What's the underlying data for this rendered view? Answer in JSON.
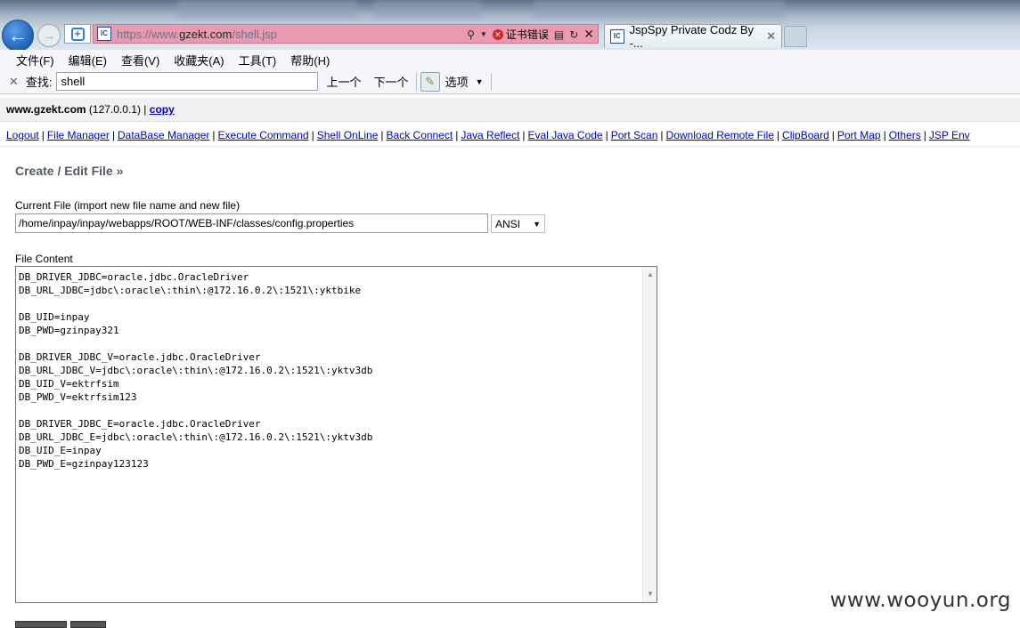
{
  "browser": {
    "url_prefix": "https://www.",
    "url_domain": "gzekt.com",
    "url_path": "/shell.jsp",
    "site_icon": "IC",
    "cert_error": "证书错误",
    "tab_title": "JspSpy Private Codz By -...",
    "menu": [
      "文件(F)",
      "编辑(E)",
      "查看(V)",
      "收藏夹(A)",
      "工具(T)",
      "帮助(H)"
    ],
    "find": {
      "label": "查找:",
      "value": "shell",
      "prev": "上一个",
      "next": "下一个",
      "options": "选项"
    }
  },
  "page": {
    "host": "www.gzekt.com",
    "ip": "(127.0.0.1)",
    "copy_link": "copy",
    "nav_links": [
      "Logout",
      "File Manager",
      "DataBase Manager",
      "Execute Command",
      "Shell OnLine",
      "Back Connect",
      "Java Reflect",
      "Eval Java Code",
      "Port Scan",
      "Download Remote File",
      "ClipBoard",
      "Port Map",
      "Others",
      "JSP Env"
    ],
    "section_title": "Create / Edit File »",
    "current_file_label": "Current File (import new file name and new file)",
    "current_file_value": "/home/inpay/inpay/webapps/ROOT/WEB-INF/classes/config.properties",
    "encoding": "ANSI",
    "file_content_label": "File Content",
    "file_content": "DB_DRIVER_JDBC=oracle.jdbc.OracleDriver\nDB_URL_JDBC=jdbc\\:oracle\\:thin\\:@172.16.0.2\\:1521\\:yktbike\n\nDB_UID=inpay\nDB_PWD=gzinpay321\n\nDB_DRIVER_JDBC_V=oracle.jdbc.OracleDriver\nDB_URL_JDBC_V=jdbc\\:oracle\\:thin\\:@172.16.0.2\\:1521\\:yktv3db\nDB_UID_V=ektrfsim\nDB_PWD_V=ektrfsim123\n\nDB_DRIVER_JDBC_E=oracle.jdbc.OracleDriver\nDB_URL_JDBC_E=jdbc\\:oracle\\:thin\\:@172.16.0.2\\:1521\\:yktv3db\nDB_UID_E=inpay\nDB_PWD_E=gzinpay123123"
  },
  "watermark": "www.wooyun.org"
}
